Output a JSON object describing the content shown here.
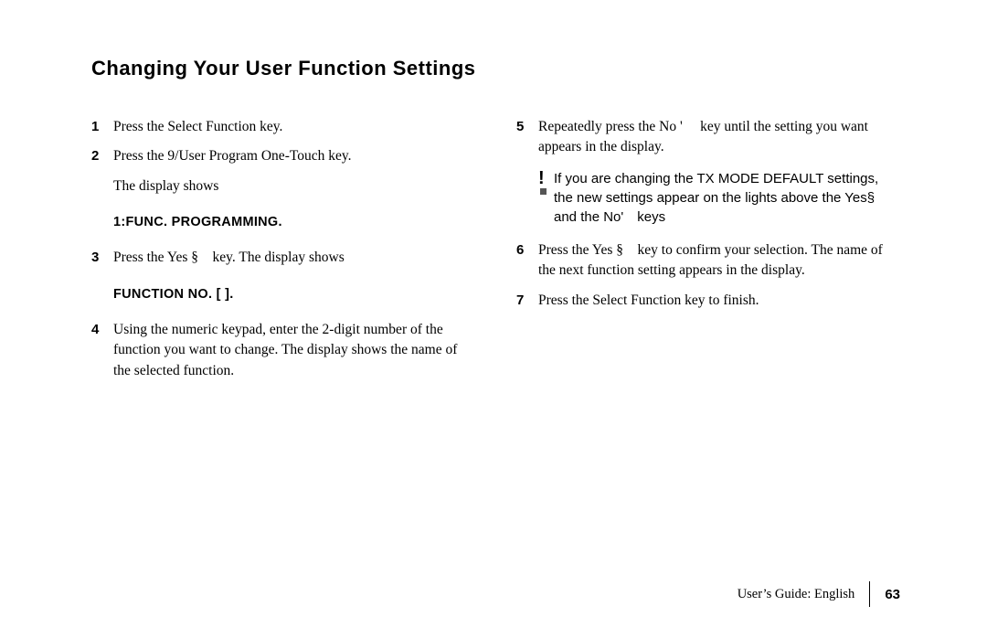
{
  "heading": "Changing Your User Function Settings",
  "left": {
    "step1": {
      "num": "1",
      "text": "Press the Select Function key."
    },
    "step2": {
      "num": "2",
      "text": "Press the 9/User Program One-Touch key."
    },
    "step2b": "The display shows",
    "display1": "1:FUNC. PROGRAMMING.",
    "step3": {
      "num": "3",
      "text": "Press the Yes § key. The display shows"
    },
    "display2": "FUNCTION NO. [ ].",
    "step4": {
      "num": "4",
      "text": "Using the numeric keypad, enter the 2-digit number of the function you want to change. The display shows the name of the selected function."
    }
  },
  "right": {
    "step5": {
      "num": "5",
      "text": "Repeatedly press the No '  key until the setting you want appears in the display."
    },
    "note": "If you are changing the TX MODE DEFAULT settings, the new settings appear on the lights above the Yes§ and the No' keys",
    "step6": {
      "num": "6",
      "text": "Press the Yes § key to confirm your selection. The name of the next function setting appears in the display."
    },
    "step7": {
      "num": "7",
      "text": "Press the Select Function key to finish."
    }
  },
  "footer": {
    "label": "User’s Guide:  English",
    "page": "63"
  }
}
